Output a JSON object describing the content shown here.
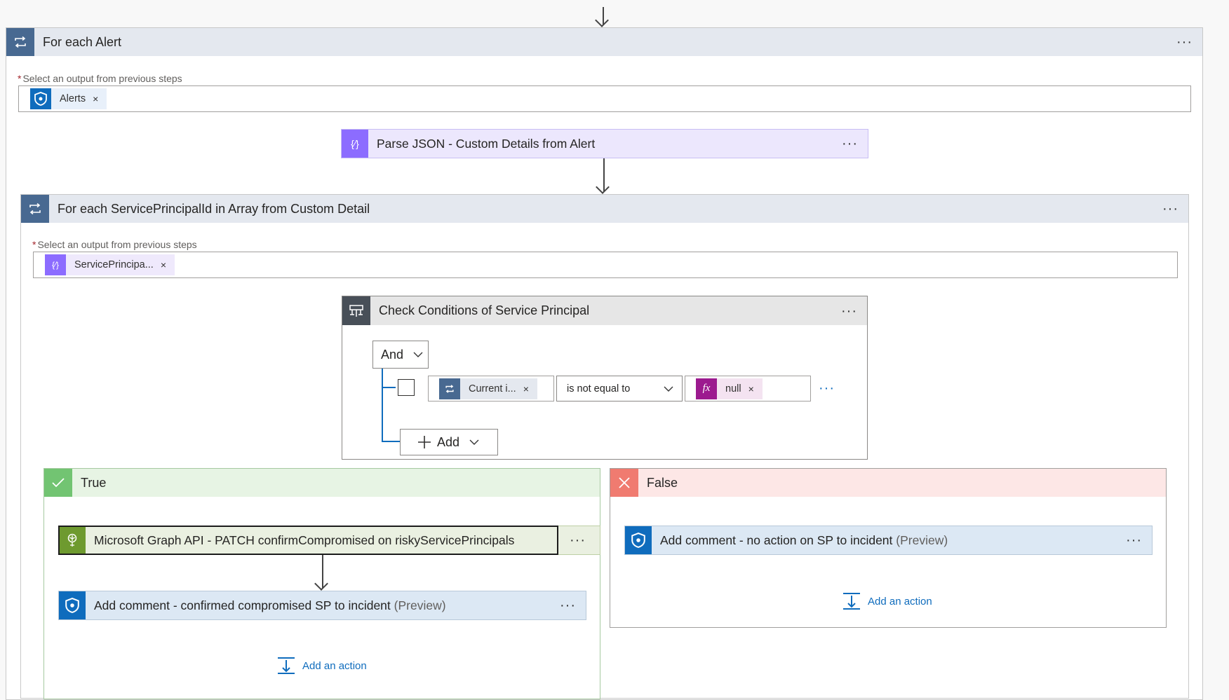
{
  "outer_loop": {
    "title": "For each Alert",
    "more": "···",
    "select_label": "Select an output from previous steps",
    "required_mark": "*",
    "token": {
      "label": "Alerts",
      "remove": "×",
      "icon": "sentinel-shield-icon"
    }
  },
  "parse_json": {
    "title": "Parse JSON - Custom Details from Alert",
    "more": "···",
    "icon": "curly-braces-icon"
  },
  "inner_loop": {
    "title": "For each ServicePrincipalId in Array from Custom Detail",
    "more": "···",
    "select_label": "Select an output from previous steps",
    "required_mark": "*",
    "token": {
      "label": "ServicePrincipa...",
      "remove": "×",
      "icon": "curly-braces-icon"
    }
  },
  "condition": {
    "title": "Check Conditions of Service Principal",
    "more": "···",
    "group_operator": "And",
    "row": {
      "left_token": "Current i...",
      "left_remove": "×",
      "operator": "is not equal to",
      "right_token": "null",
      "right_remove": "×",
      "right_icon_label": "fx",
      "more": "···"
    },
    "add_label": "Add"
  },
  "true_branch": {
    "title": "True",
    "actions": [
      {
        "title": "Microsoft Graph API - PATCH confirmCompromised on riskyServicePrincipals",
        "suffix": "",
        "more": "···"
      },
      {
        "title": "Add comment - confirmed compromised SP to incident",
        "suffix": "(Preview)",
        "more": "···"
      }
    ],
    "add_action": "Add an action"
  },
  "false_branch": {
    "title": "False",
    "actions": [
      {
        "title": "Add comment - no action on SP to incident",
        "suffix": "(Preview)",
        "more": "···"
      }
    ],
    "add_action": "Add an action"
  },
  "colors": {
    "loop_header": "#e4e8ef",
    "loop_icon": "#486991",
    "json_purple": "#8c6cff",
    "json_header": "#ece7fd",
    "condition_icon": "#484f58",
    "true_green": "#72c472",
    "true_header": "#e7f4e4",
    "false_red": "#f07b70",
    "false_header": "#fde7e6",
    "graph_green": "#6e9a2f",
    "graph_header": "#eaf0e1",
    "sentinel_blue": "#0f6cbd",
    "sentinel_header": "#dce8f4",
    "fx_magenta": "#9c1a8f"
  }
}
